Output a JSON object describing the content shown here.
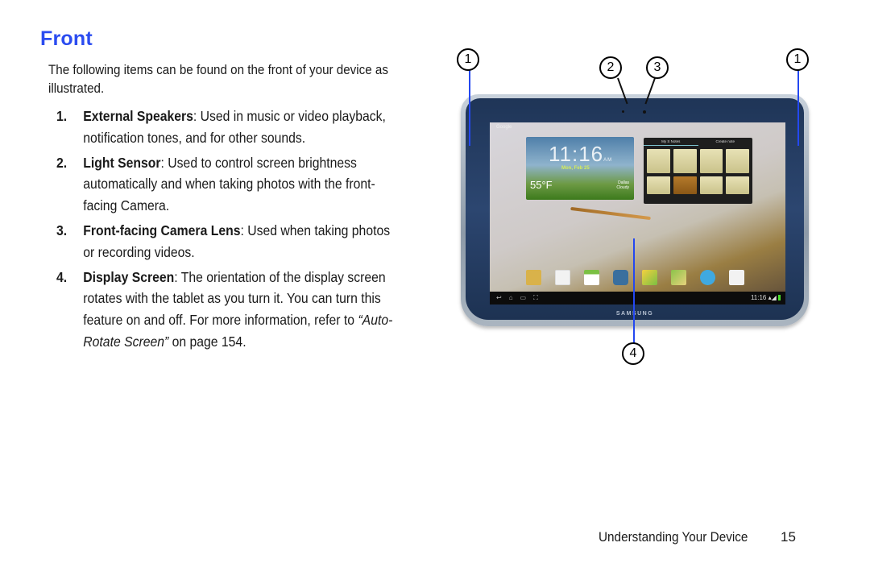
{
  "section": {
    "title": "Front",
    "intro": "The following items can be found on the front of your device as illustrated."
  },
  "items": [
    {
      "num": "1.",
      "term": "External Speakers",
      "desc": ": Used in music or video playback, notification tones, and for other sounds."
    },
    {
      "num": "2.",
      "term": "Light Sensor",
      "desc": ": Used to control screen brightness automatically and when taking photos with the front-facing Camera."
    },
    {
      "num": "3.",
      "term": "Front-facing Camera Lens",
      "desc": ": Used when taking photos or recording videos."
    },
    {
      "num": "4.",
      "term": "Display Screen",
      "desc": ": The orientation of the display screen rotates with the tablet as you turn it. You can turn this feature on and off. For more information, refer to ",
      "ref": "“Auto-Rotate Screen”",
      "ref_suffix": "  on page 154."
    }
  ],
  "figure": {
    "callouts": [
      "1",
      "2",
      "3",
      "1",
      "4"
    ],
    "accent_color": "#2448f0",
    "tablet": {
      "brand": "SAMSUNG",
      "google_label": "Google",
      "weather_time": "11:16",
      "weather_ampm": "AM",
      "weather_date": "Mon, Feb 25",
      "weather_temp": "55°F",
      "weather_city": "Dallas",
      "weather_condition": "Cloudy",
      "notes_tabs": [
        "My S Notes",
        "Create note"
      ],
      "status_time": "11:16"
    }
  },
  "footer": {
    "chapter": "Understanding Your Device",
    "page": "15"
  }
}
